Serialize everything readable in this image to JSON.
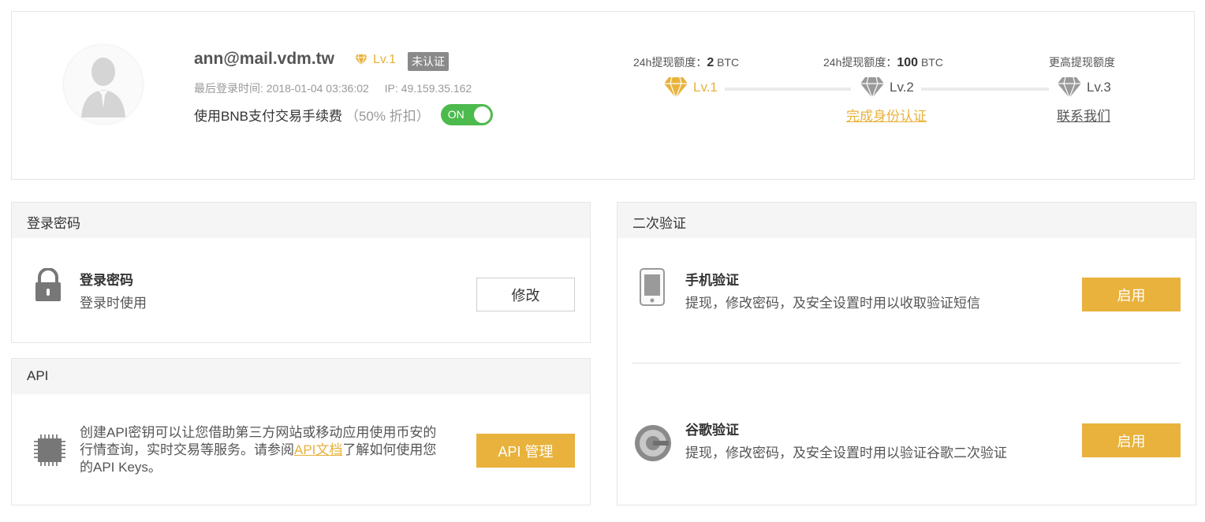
{
  "profile": {
    "email": "ann@mail.vdm.tw",
    "level": "Lv.1",
    "verify_badge": "未认证",
    "last_login_label": "最后登录时间: 2018-01-04 03:36:02",
    "ip_label": "IP: 49.159.35.162",
    "bnb_label": "使用BNB支付交易手续费",
    "bnb_discount": "（50% 折扣）",
    "toggle_label": "ON"
  },
  "limits": {
    "lv1": {
      "label": "24h提现额度：",
      "amount": "2",
      "unit": " BTC",
      "level": "Lv.1"
    },
    "lv2": {
      "label": "24h提现额度：",
      "amount": "100",
      "unit": " BTC",
      "level": "Lv.2",
      "action": "完成身份认证"
    },
    "lv3": {
      "label": "更高提现额度",
      "level": "Lv.3",
      "action": "联系我们"
    }
  },
  "login_password": {
    "header": "登录密码",
    "title": "登录密码",
    "desc": "登录时使用",
    "button": "修改"
  },
  "api": {
    "header": "API",
    "desc_before": "创建API密钥可以让您借助第三方网站或移动应用使用币安的行情查询，实时交易等服务。请参阅",
    "desc_link": "API文档",
    "desc_after": "了解如何使用您的API Keys。",
    "button": "API 管理"
  },
  "two_factor": {
    "header": "二次验证",
    "sms": {
      "title": "手机验证",
      "desc": "提现，修改密码，及安全设置时用以收取验证短信",
      "button": "启用"
    },
    "google": {
      "title": "谷歌验证",
      "desc": "提现，修改密码，及安全设置时用以验证谷歌二次验证",
      "button": "启用"
    }
  },
  "colors": {
    "gold": "#e8b23c",
    "toggle_on": "#4cba4c",
    "badge": "#8a8a8a",
    "gray_diamond": "#9a9a9a"
  },
  "icons": [
    "user-avatar-icon",
    "gold-diamond-icon",
    "gray-diamond-icon",
    "lock-icon",
    "chip-icon",
    "phone-icon",
    "google-authenticator-icon"
  ]
}
